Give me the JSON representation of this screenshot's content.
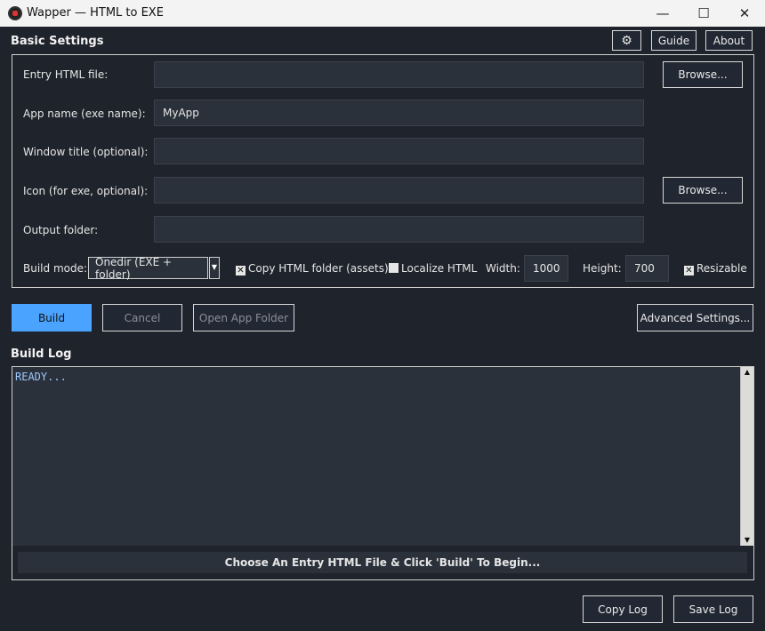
{
  "window": {
    "title": "Wapper — HTML to EXE",
    "minimize": "—",
    "maximize": "☐",
    "close": "✕"
  },
  "header": {
    "section_title": "Basic Settings",
    "gear_icon": "⚙",
    "guide": "Guide",
    "about": "About"
  },
  "fields": [
    {
      "label": "Entry HTML file:",
      "value": "",
      "browse": "Browse..."
    },
    {
      "label": "App name (exe name):",
      "value": "MyApp"
    },
    {
      "label": "Window title (optional):",
      "value": ""
    },
    {
      "label": "Icon (for exe, optional):",
      "value": "",
      "browse": "Browse..."
    },
    {
      "label": "Output folder:",
      "value": ""
    }
  ],
  "options": {
    "build_mode_label": "Build mode:",
    "build_mode_value": "Onedir (EXE + folder)",
    "copy_html": {
      "label": "Copy HTML folder (assets)",
      "checked": true,
      "mark": "✕"
    },
    "localize": {
      "label": "Localize HTML",
      "checked": false
    },
    "width_label": "Width:",
    "width_value": "1000",
    "height_label": "Height:",
    "height_value": "700",
    "resizable": {
      "label": "Resizable",
      "checked": true,
      "mark": "✕"
    }
  },
  "actions": {
    "build": "Build",
    "cancel": "Cancel",
    "open_folder": "Open App Folder",
    "advanced": "Advanced Settings..."
  },
  "log": {
    "title": "Build Log",
    "text": "READY...",
    "status": "Choose An Entry HTML File & Click 'Build' To Begin...",
    "copy": "Copy Log",
    "save": "Save Log"
  }
}
